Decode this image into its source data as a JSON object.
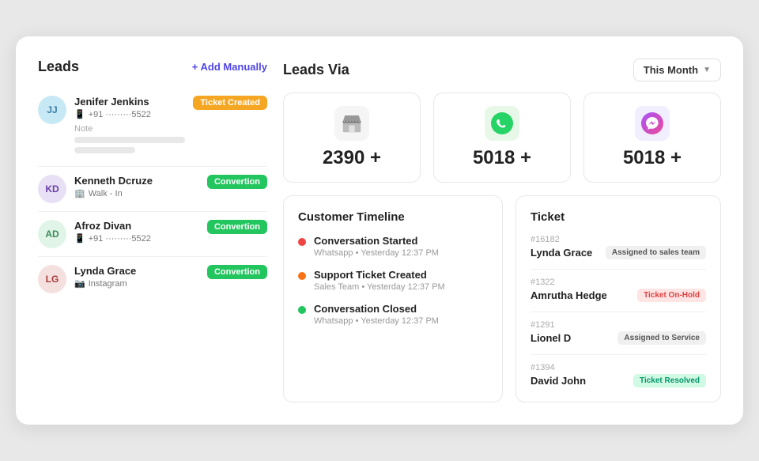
{
  "left": {
    "title": "Leads",
    "add_button": "+ Add Manually",
    "leads": [
      {
        "initials": "JJ",
        "avatar_class": "avatar-jj",
        "name": "Jenifer Jenkins",
        "sub_type": "whatsapp",
        "sub_text": "+91 ·········5522",
        "badge": "Ticket Created",
        "badge_class": "badge-ticket",
        "has_note": true
      },
      {
        "initials": "KD",
        "avatar_class": "avatar-kd",
        "name": "Kenneth Dcruze",
        "sub_type": "walkin",
        "sub_text": "Walk - In",
        "badge": "Convertion",
        "badge_class": "badge-conversion",
        "has_note": false
      },
      {
        "initials": "AD",
        "avatar_class": "avatar-ad",
        "name": "Afroz Divan",
        "sub_type": "whatsapp",
        "sub_text": "+91 ·········5522",
        "badge": "Convertion",
        "badge_class": "badge-conversion",
        "has_note": false
      },
      {
        "initials": "LG",
        "avatar_class": "avatar-lg",
        "name": "Lynda Grace",
        "sub_type": "instagram",
        "sub_text": "Instagram",
        "badge": "Convertion",
        "badge_class": "badge-conversion",
        "has_note": false
      }
    ]
  },
  "right": {
    "leads_via_title": "Leads Via",
    "month_selector": "This Month",
    "via_cards": [
      {
        "icon": "🏪",
        "count": "2390 +",
        "bg": "#f5f5f5"
      },
      {
        "icon": "📱",
        "count": "5018 +",
        "bg": "#e8f8e8",
        "icon_color": "green"
      },
      {
        "icon": "💬",
        "count": "5018 +",
        "bg": "#f0eeff",
        "icon_color": "purple"
      }
    ],
    "timeline": {
      "title": "Customer Timeline",
      "items": [
        {
          "dot": "dot-red",
          "event": "Conversation Started",
          "meta": "Whatsapp  •  Yesterday 12:37 PM"
        },
        {
          "dot": "dot-orange",
          "event": "Support Ticket Created",
          "meta": "Sales Team  •  Yesterday 12:37 PM"
        },
        {
          "dot": "dot-green",
          "event": "Conversation Closed",
          "meta": "Whatsapp  •  Yesterday 12:37 PM"
        }
      ]
    },
    "ticket": {
      "title": "Ticket",
      "items": [
        {
          "id": "#16182",
          "name": "Lynda Grace",
          "badge": "Assigned to sales team",
          "badge_class": "tb-sales"
        },
        {
          "id": "#1322",
          "name": "Amrutha Hedge",
          "badge": "Ticket On-Hold",
          "badge_class": "tb-onhold"
        },
        {
          "id": "#1291",
          "name": "Lionel D",
          "badge": "Assigned to Service",
          "badge_class": "tb-service"
        },
        {
          "id": "#1394",
          "name": "David John",
          "badge": "Ticket Resolved",
          "badge_class": "tb-resolved"
        }
      ]
    }
  }
}
